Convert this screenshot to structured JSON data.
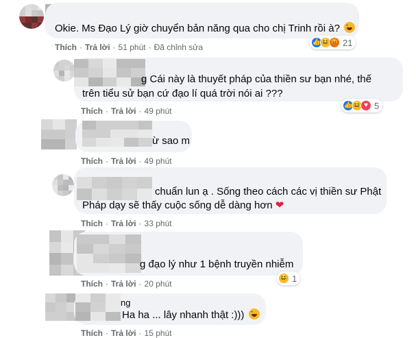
{
  "colors": {
    "bubble_bg": "#f0f2f5",
    "meta_text": "#65676b",
    "like_blue": "#1877f2",
    "haha_yellow": "#f7b928",
    "angry_orange": "#e9710f",
    "love_red": "#f33e58"
  },
  "actions": {
    "like": "Thích",
    "reply": "Trả lời",
    "separator": "·"
  },
  "comments": [
    {
      "text_line1": "Okie. Ms Đạo Lý giờ chuyển bản năng qua cho chị Trinh rồi à?",
      "inline_emoji": "haha-emoji",
      "time": "51 phút",
      "edited": "Đã chỉnh sửa",
      "reactions": [
        "like",
        "haha",
        "angry"
      ],
      "reaction_count": "21"
    },
    {
      "text_line1": "g Cái này là thuyết pháp của thiền sư bạn nhé, thế",
      "text_line2": "trên tiểu sử bạn cứ đạo lí quá trời nói ai ???",
      "time": "49 phút",
      "reactions": [
        "like",
        "haha",
        "love"
      ],
      "reaction_count": "5"
    },
    {
      "text_line1": "ừ sao m",
      "time": "49 phút"
    },
    {
      "text_line1": "chuẩn lun ạ . Sống theo cách các vị thiền sư Phật",
      "text_line2": "Pháp dạy sẽ thấy cuộc sống dễ dàng hơn",
      "inline_emoji": "heart-emoji",
      "time": "33 phút"
    },
    {
      "text_line1": "g đạo lý như 1 bệnh truyền nhiễm",
      "time": "20 phút",
      "reactions": [
        "haha"
      ],
      "reaction_count": "1"
    },
    {
      "text_line1": "ng",
      "text_line2": "Ha ha ... lây nhanh thật :)))",
      "inline_emoji": "haha-emoji",
      "time": "15 phút"
    }
  ]
}
